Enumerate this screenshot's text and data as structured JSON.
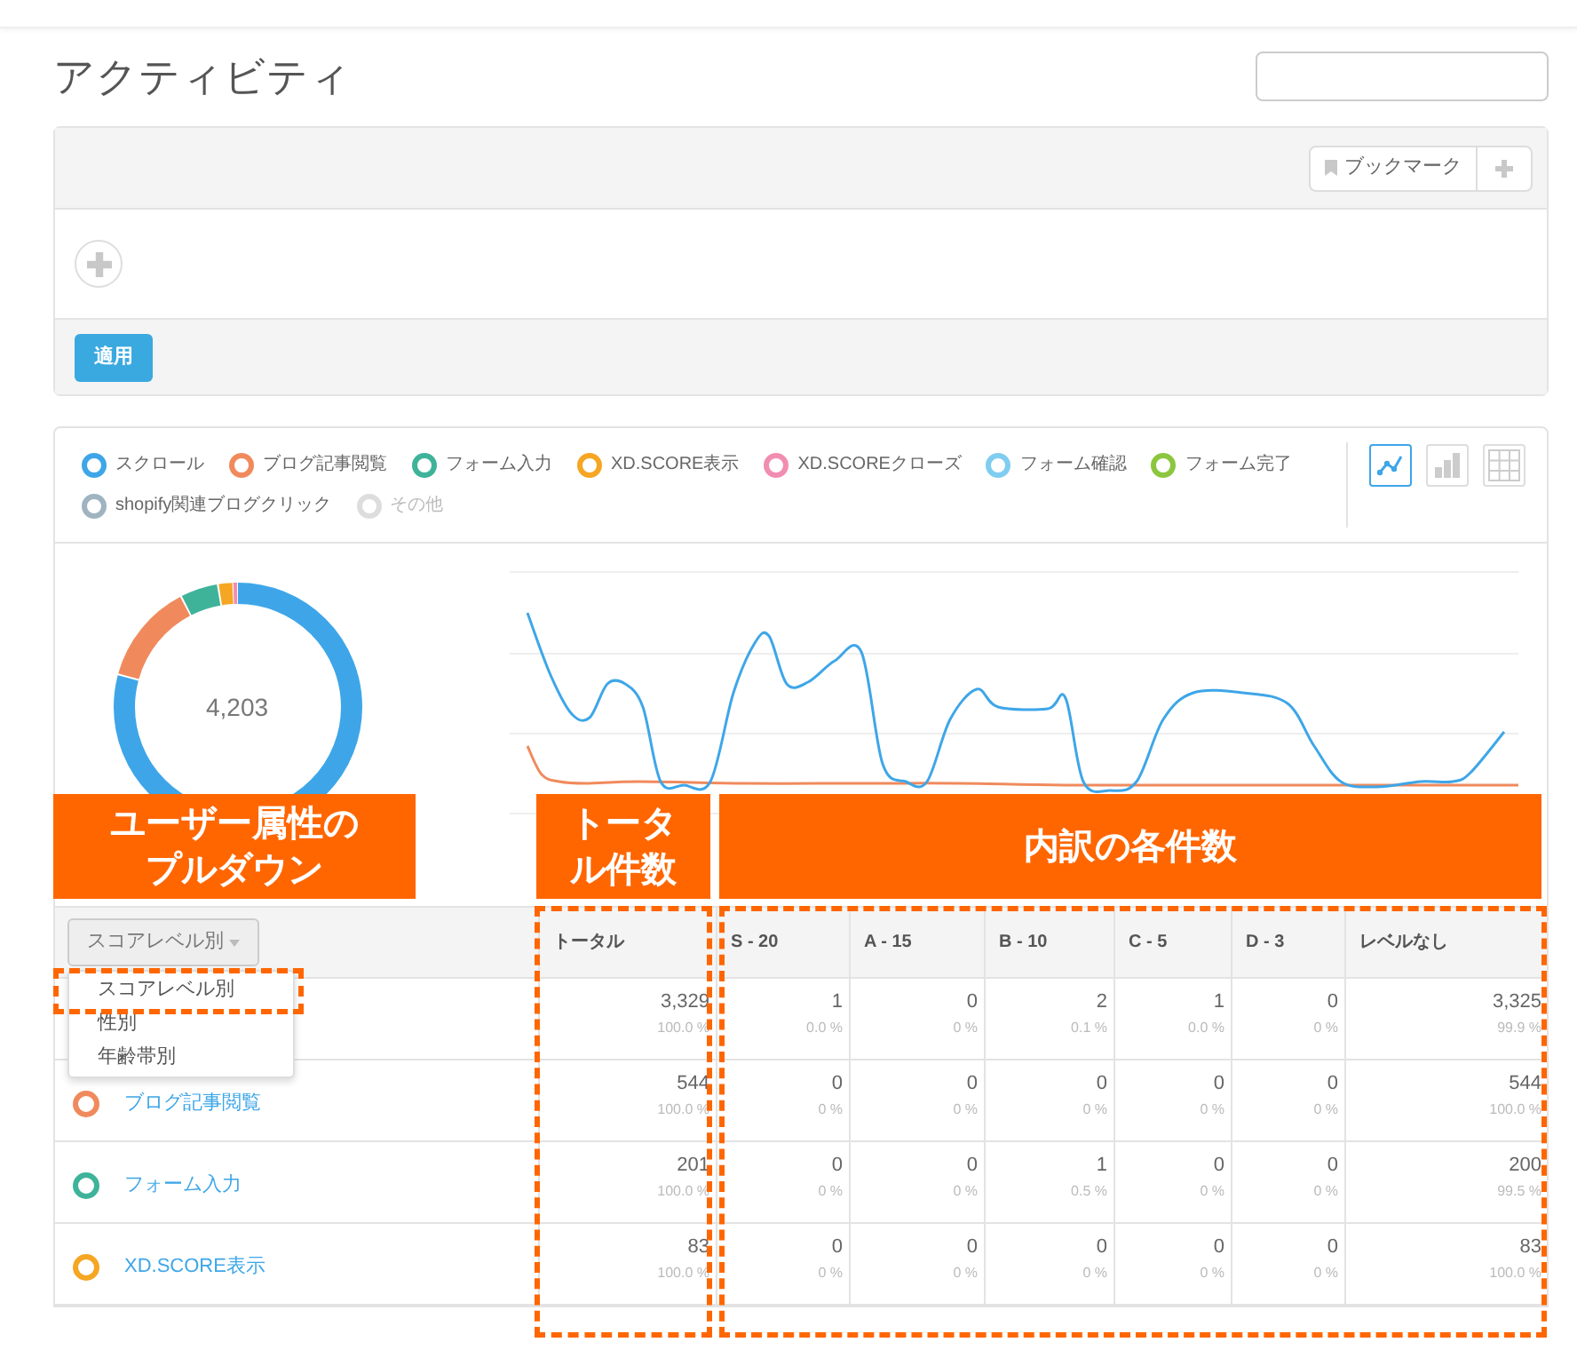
{
  "page": {
    "title": "アクティビティ"
  },
  "filter_panel": {
    "bookmark_button": "ブックマーク",
    "apply_button": "適用"
  },
  "legend": [
    {
      "label": "スクロール",
      "color": "#3ea6e8",
      "disabled": false
    },
    {
      "label": "ブログ記事閲覧",
      "color": "#f08a5d",
      "disabled": false
    },
    {
      "label": "フォーム入力",
      "color": "#3fb39a",
      "disabled": false
    },
    {
      "label": "XD.SCORE表示",
      "color": "#f5a623",
      "disabled": false
    },
    {
      "label": "XD.SCOREクローズ",
      "color": "#f28db2",
      "disabled": false
    },
    {
      "label": "フォーム確認",
      "color": "#7fcdf0",
      "disabled": false
    },
    {
      "label": "フォーム完了",
      "color": "#8cc63f",
      "disabled": false
    },
    {
      "label": "shopify関連ブログクリック",
      "color": "#9fb3c0",
      "disabled": false
    },
    {
      "label": "その他",
      "color": "#dddddd",
      "disabled": true
    }
  ],
  "view_buttons": [
    {
      "kind": "line",
      "selected": true
    },
    {
      "kind": "bar",
      "selected": false
    },
    {
      "kind": "table",
      "selected": false
    }
  ],
  "donut": {
    "total": "4,203"
  },
  "table": {
    "dropdown": {
      "value": "スコアレベル別",
      "options": [
        "スコアレベル別",
        "性別",
        "年齢帯別"
      ]
    },
    "columns": [
      "トータル",
      "S - 20",
      "A - 15",
      "B - 10",
      "C - 5",
      "D - 3",
      "レベルなし"
    ],
    "rows": [
      {
        "cells": [
          [
            "3,329",
            "100.0 %"
          ],
          [
            "1",
            "0.0 %"
          ],
          [
            "0",
            "0 %"
          ],
          [
            "2",
            "0.1 %"
          ],
          [
            "1",
            "0.0 %"
          ],
          [
            "0",
            "0 %"
          ],
          [
            "3,325",
            "99.9 %"
          ]
        ]
      },
      {
        "name": "ブログ記事閲覧",
        "color": "#f08a5d",
        "cells": [
          [
            "544",
            "100.0 %"
          ],
          [
            "0",
            "0 %"
          ],
          [
            "0",
            "0 %"
          ],
          [
            "0",
            "0 %"
          ],
          [
            "0",
            "0 %"
          ],
          [
            "0",
            "0 %"
          ],
          [
            "544",
            "100.0 %"
          ]
        ]
      },
      {
        "name": "フォーム入力",
        "color": "#3fb39a",
        "cells": [
          [
            "201",
            "100.0 %"
          ],
          [
            "0",
            "0 %"
          ],
          [
            "0",
            "0 %"
          ],
          [
            "1",
            "0.5 %"
          ],
          [
            "0",
            "0 %"
          ],
          [
            "0",
            "0 %"
          ],
          [
            "200",
            "99.5 %"
          ]
        ]
      },
      {
        "name": "XD.SCORE表示",
        "color": "#f5a623",
        "cells": [
          [
            "83",
            "100.0 %"
          ],
          [
            "0",
            "0 %"
          ],
          [
            "0",
            "0 %"
          ],
          [
            "0",
            "0 %"
          ],
          [
            "0",
            "0 %"
          ],
          [
            "0",
            "0 %"
          ],
          [
            "83",
            "100.0 %"
          ]
        ]
      }
    ]
  },
  "callouts": [
    {
      "label": "ユーザー属性のプルダウン"
    },
    {
      "label": "トータル件数"
    },
    {
      "label": "内訳の各件数"
    }
  ]
}
